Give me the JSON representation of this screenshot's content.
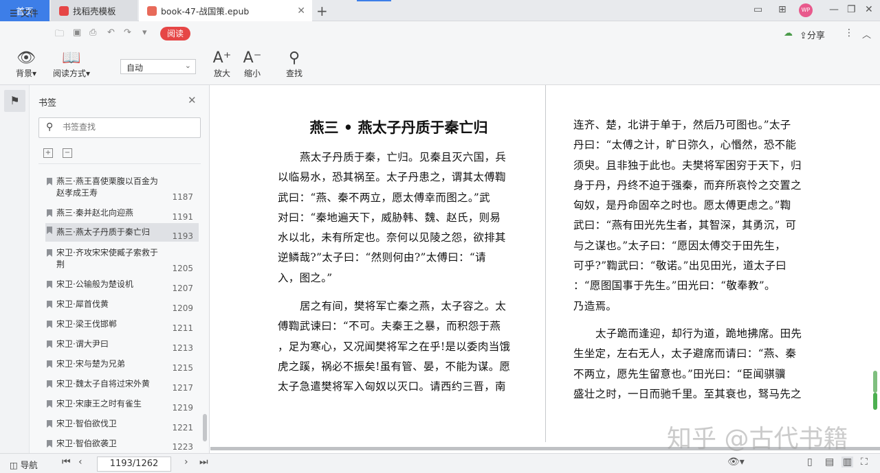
{
  "tabs": {
    "home": "首页",
    "template": "找稻壳模板",
    "book": "book-47-战国策.epub"
  },
  "avatar_text": "WP",
  "menu": {
    "file": "文件",
    "read_pill": "阅读",
    "share": "分享"
  },
  "toolbar": {
    "background": "背景",
    "read_mode": "阅读方式",
    "mode_value": "自动",
    "zoom_in": "放大",
    "zoom_out": "缩小",
    "find": "查找"
  },
  "sidebar": {
    "title": "书签",
    "search_placeholder": "书签查找",
    "items": [
      {
        "label": "燕三·燕王喜使栗腹以百金为赵孝成王寿",
        "page": "1187"
      },
      {
        "label": "燕三·秦并赵北向迎燕",
        "page": "1191"
      },
      {
        "label": "燕三·燕太子丹质于秦亡归",
        "page": "1193"
      },
      {
        "label": "宋卫·齐攻宋宋使臧子索救于荆",
        "page": "1205"
      },
      {
        "label": "宋卫·公输般为楚设机",
        "page": "1207"
      },
      {
        "label": "宋卫·犀首伐黄",
        "page": "1209"
      },
      {
        "label": "宋卫·梁王伐邯郸",
        "page": "1211"
      },
      {
        "label": "宋卫·谓大尹曰",
        "page": "1213"
      },
      {
        "label": "宋卫·宋与楚为兄弟",
        "page": "1215"
      },
      {
        "label": "宋卫·魏太子自将过宋外黄",
        "page": "1217"
      },
      {
        "label": "宋卫·宋康王之时有雀生",
        "page": "1219"
      },
      {
        "label": "宋卫·智伯欲伐卫",
        "page": "1221"
      },
      {
        "label": "宋卫·智伯欲袭卫",
        "page": "1223"
      }
    ]
  },
  "document": {
    "title": "燕三 • 燕太子丹质于秦亡归",
    "left_p1": [
      "燕太子丹质于秦，亡归。见秦且灭六国，兵",
      "以临易水，恐其祸至。太子丹患之，谓其太傅鞫",
      "武曰：“燕、秦不两立，愿太傅幸而图之。”武",
      "对曰：“秦地遍天下，威胁韩、魏、赵氏，则易",
      "水以北，未有所定也。奈何以见陵之怨，欲排其",
      "逆鳞哉?”太子曰：“然则何由?”太傅曰：“请",
      "入，图之。”"
    ],
    "left_p2": [
      "居之有间，樊将军亡秦之燕，太子容之。太",
      "傅鞫武谏曰：“不可。夫秦王之暴，而积怨于燕",
      "，足为寒心，又况闻樊将军之在乎!是以委肉当饿",
      "虎之蹊，祸必不振矣!虽有管、晏，不能为谋。愿",
      "太子急遣樊将军入匈奴以灭口。请西约三晋，南"
    ],
    "right_p1": [
      "连齐、楚，北讲于单于，然后乃可图也。”太子",
      "丹曰：“太傅之计，旷日弥久，心惽然，恐不能",
      "须臾。且非独于此也。夫樊将军困穷于天下，归",
      "身于丹，丹终不迫于强秦，而弃所哀怜之交置之",
      "匈奴，是丹命固卒之时也。愿太傅更虑之。”鞫",
      "武曰：“燕有田光先生者，其智深，其勇沉，可",
      "与之谋也。”太子曰：“愿因太傅交于田先生，",
      "可乎?”鞫武曰：“敬诺。”出见田光，道太子曰",
      "：“愿图国事于先生。”田光曰：“敬奉教”。",
      "乃造焉。"
    ],
    "right_p2": [
      "太子跪而逢迎，却行为道，跪地拂席。田先",
      "生坐定，左右无人，太子避席而请曰：“燕、秦",
      "不两立，愿先生留意也。”田光曰：“臣闻骐骥",
      "盛壮之时，一日而驰千里。至其衰也，驽马先之"
    ]
  },
  "watermark": "知乎 @古代书籍",
  "status": {
    "nav": "导航",
    "page": "1193/1262"
  }
}
